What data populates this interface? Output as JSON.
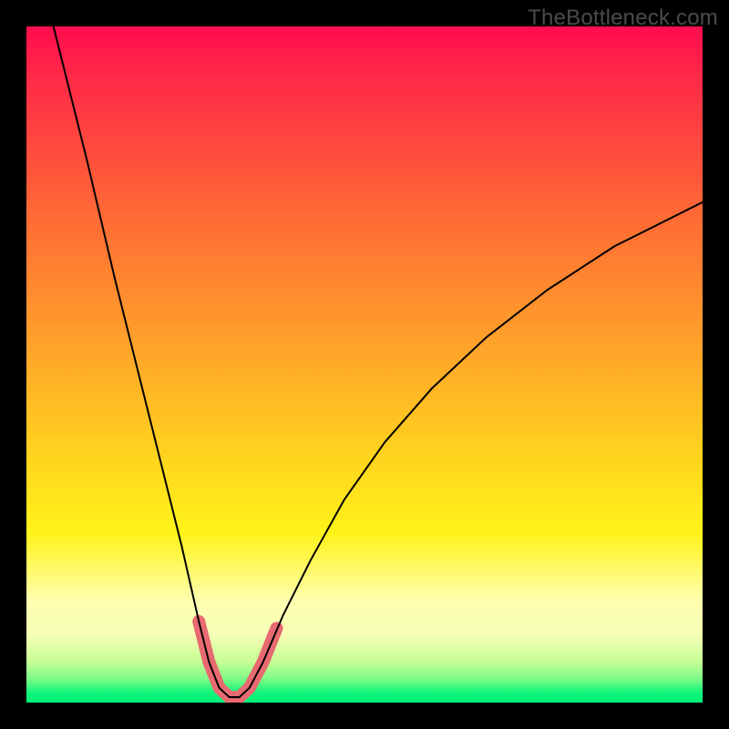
{
  "watermark": "TheBottleneck.com",
  "chart_data": {
    "type": "line",
    "title": "",
    "xlabel": "",
    "ylabel": "",
    "xlim": [
      0,
      100
    ],
    "ylim": [
      0,
      100
    ],
    "grid": false,
    "legend_position": "none",
    "gradient_stops": [
      {
        "color": "#ff0d4e",
        "pos_pct": 0
      },
      {
        "color": "#ff2b47",
        "pos_pct": 8
      },
      {
        "color": "#ff6a35",
        "pos_pct": 28
      },
      {
        "color": "#ffa22a",
        "pos_pct": 47
      },
      {
        "color": "#ffd21e",
        "pos_pct": 63
      },
      {
        "color": "#fff31a",
        "pos_pct": 75
      },
      {
        "color": "#ffffb0",
        "pos_pct": 85
      },
      {
        "color": "#f5ffb5",
        "pos_pct": 90
      },
      {
        "color": "#c6fd93",
        "pos_pct": 94
      },
      {
        "color": "#7dfb88",
        "pos_pct": 96.5
      },
      {
        "color": "#13f57b",
        "pos_pct": 98.5
      },
      {
        "color": "#00f07a",
        "pos_pct": 100
      }
    ],
    "series": [
      {
        "name": "main-curve",
        "stroke": "#000000",
        "stroke_width": 2,
        "data": [
          {
            "x": 4.0,
            "y": 100.0
          },
          {
            "x": 6.0,
            "y": 92.0
          },
          {
            "x": 9.0,
            "y": 80.0
          },
          {
            "x": 13.0,
            "y": 63.0
          },
          {
            "x": 17.0,
            "y": 47.0
          },
          {
            "x": 20.0,
            "y": 35.0
          },
          {
            "x": 23.0,
            "y": 23.0
          },
          {
            "x": 25.5,
            "y": 12.0
          },
          {
            "x": 27.0,
            "y": 6.0
          },
          {
            "x": 28.5,
            "y": 2.2
          },
          {
            "x": 30.0,
            "y": 0.8
          },
          {
            "x": 31.5,
            "y": 0.8
          },
          {
            "x": 33.0,
            "y": 2.2
          },
          {
            "x": 35.0,
            "y": 6.0
          },
          {
            "x": 38.0,
            "y": 13.0
          },
          {
            "x": 42.0,
            "y": 21.0
          },
          {
            "x": 47.0,
            "y": 30.0
          },
          {
            "x": 53.0,
            "y": 38.5
          },
          {
            "x": 60.0,
            "y": 46.5
          },
          {
            "x": 68.0,
            "y": 54.0
          },
          {
            "x": 77.0,
            "y": 61.0
          },
          {
            "x": 87.0,
            "y": 67.5
          },
          {
            "x": 100.0,
            "y": 74.0
          }
        ]
      },
      {
        "name": "highlight-segment",
        "stroke": "#e86a71",
        "stroke_width": 14,
        "data": [
          {
            "x": 25.5,
            "y": 12.0
          },
          {
            "x": 27.0,
            "y": 6.0
          },
          {
            "x": 28.5,
            "y": 2.2
          },
          {
            "x": 30.0,
            "y": 0.8
          },
          {
            "x": 31.5,
            "y": 0.8
          },
          {
            "x": 33.0,
            "y": 2.2
          },
          {
            "x": 35.0,
            "y": 6.0
          },
          {
            "x": 37.0,
            "y": 11.0
          }
        ]
      }
    ]
  }
}
